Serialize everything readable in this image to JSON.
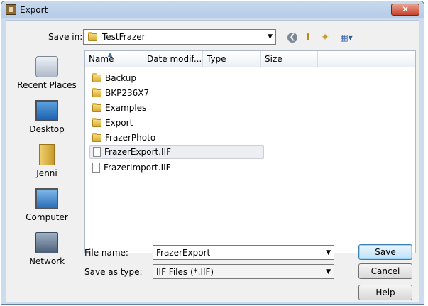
{
  "window": {
    "title": "Export",
    "close_glyph": "✕"
  },
  "toolbar": {
    "save_in_label": "Save in:",
    "location": "TestFrazer",
    "back_glyph": "❮",
    "up_glyph": "⬆",
    "newfolder_glyph": "✦",
    "views_glyph": "▦▾"
  },
  "places": [
    {
      "label": "Recent Places",
      "icon": "recent-places-icon"
    },
    {
      "label": "Desktop",
      "icon": "desktop-icon"
    },
    {
      "label": "Jenni",
      "icon": "user-folder-icon"
    },
    {
      "label": "Computer",
      "icon": "computer-icon"
    },
    {
      "label": "Network",
      "icon": "network-icon"
    }
  ],
  "columns": [
    "Name",
    "Date modif...",
    "Type",
    "Size"
  ],
  "files": [
    {
      "name": "Backup",
      "kind": "folder"
    },
    {
      "name": "BKP236X7",
      "kind": "folder"
    },
    {
      "name": "Examples",
      "kind": "folder"
    },
    {
      "name": "Export",
      "kind": "folder"
    },
    {
      "name": "FrazerPhoto",
      "kind": "folder"
    },
    {
      "name": "FrazerExport.IIF",
      "kind": "file",
      "selected": true
    },
    {
      "name": "FrazerImport.IIF",
      "kind": "file"
    }
  ],
  "form": {
    "filename_label": "File name:",
    "filename_value": "FrazerExport",
    "savetype_label": "Save as type:",
    "savetype_value": "IIF Files (*.IIF)"
  },
  "buttons": {
    "save": "Save",
    "cancel": "Cancel",
    "help": "Help"
  }
}
